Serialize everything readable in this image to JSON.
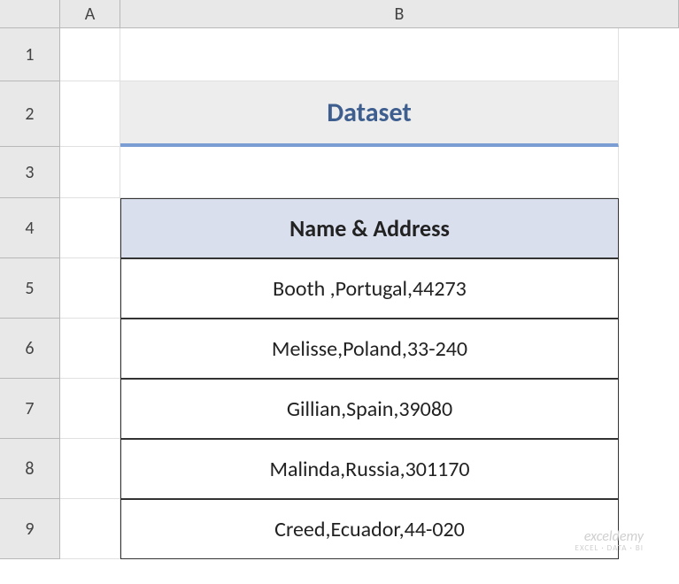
{
  "columns": {
    "A": "A",
    "B": "B"
  },
  "rows": {
    "1": "1",
    "2": "2",
    "3": "3",
    "4": "4",
    "5": "5",
    "6": "6",
    "7": "7",
    "8": "8",
    "9": "9"
  },
  "cells": {
    "B2": "Dataset",
    "B4": "Name & Address",
    "B5": "Booth ,Portugal,44273",
    "B6": "Melisse,Poland,33-240",
    "B7": "Gillian,Spain,39080",
    "B8": "Malinda,Russia,301170",
    "B9": "Creed,Ecuador,44-020"
  },
  "watermark": {
    "main": "exceldemy",
    "sub": "EXCEL · DATA · BI"
  },
  "chart_data": {
    "type": "table",
    "title": "Dataset",
    "columns": [
      "Name & Address"
    ],
    "rows": [
      [
        "Booth ,Portugal,44273"
      ],
      [
        "Melisse,Poland,33-240"
      ],
      [
        "Gillian,Spain,39080"
      ],
      [
        "Malinda,Russia,301170"
      ],
      [
        "Creed,Ecuador,44-020"
      ]
    ]
  }
}
